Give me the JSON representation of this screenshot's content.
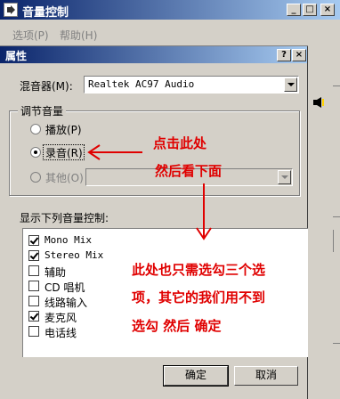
{
  "outer_window": {
    "title": "音量控制",
    "menu": [
      "选项(P)",
      "帮助(H)"
    ],
    "controls": [
      "_",
      "□",
      "×"
    ]
  },
  "dialog": {
    "title": "属性",
    "controls": [
      "?",
      "×"
    ],
    "mixer_label": "混音器(M):",
    "mixer_value": "Realtek AC97 Audio",
    "adjust_group_label": "调节音量",
    "radio_playback": "播放(P)",
    "radio_record": "录音(R)",
    "radio_other": "其他(O)",
    "selected_radio": "录音(R)",
    "show_controls_label": "显示下列音量控制:",
    "controls_list": [
      {
        "label": "Mono Mix",
        "checked": true
      },
      {
        "label": "Stereo Mix",
        "checked": true
      },
      {
        "label": "辅助",
        "checked": false
      },
      {
        "label": "CD 唱机",
        "checked": false
      },
      {
        "label": "线路输入",
        "checked": false
      },
      {
        "label": "麦克风",
        "checked": true
      },
      {
        "label": "电话线",
        "checked": false
      }
    ],
    "ok_label": "确定",
    "cancel_label": "取消"
  },
  "annotations": {
    "line1": "点击此处",
    "line2": "然后看下面",
    "line3": "此处也只需选勾三个选",
    "line4": "项，其它的我们用不到",
    "line5": "选勾  然后  确定",
    "color": "#e00000"
  }
}
